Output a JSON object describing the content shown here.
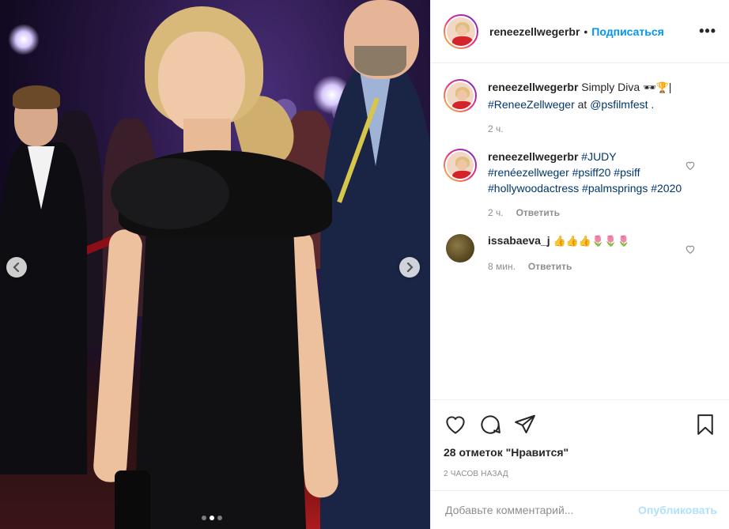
{
  "header": {
    "username": "reneezellwegerbr",
    "bullet": "•",
    "follow_label": "Подписаться",
    "more_label": "•••"
  },
  "comments": [
    {
      "username": "reneezellwegerbr",
      "text_prefix": "Simply Diva ",
      "emoji": "🕶🏆",
      "text_mid": "|",
      "tag": "#ReneeZellweger",
      "text_at": " at ",
      "mention": "@psfilmfest",
      "text_end": " .",
      "time": "2 ч."
    },
    {
      "username": "reneezellwegerbr",
      "hashtags": "#JUDY #renéezellweger #psiff20 #psiff #hollywoodactress #palmsprings #2020",
      "time": "2 ч.",
      "reply_label": "Ответить"
    },
    {
      "username": "issabaeva_j",
      "emoji": "👍👍👍🌷🌷🌷",
      "time": "8 мин.",
      "reply_label": "Ответить"
    }
  ],
  "actions": {
    "icons": [
      "heart-icon",
      "comment-icon",
      "share-icon",
      "bookmark-icon"
    ],
    "likes_text": "28 отметок \"Нравится\"",
    "posted_time": "2 ЧАСОВ НАЗАД"
  },
  "add_comment": {
    "placeholder": "Добавьте комментарий...",
    "publish_label": "Опубликовать"
  },
  "carousel": {
    "total_slides": 3,
    "active_slide": 2
  },
  "colors": {
    "accent": "#0095f6",
    "publish_disabled": "#b2dffc",
    "hashtag": "#00376b",
    "muted": "#8e8e8e"
  }
}
